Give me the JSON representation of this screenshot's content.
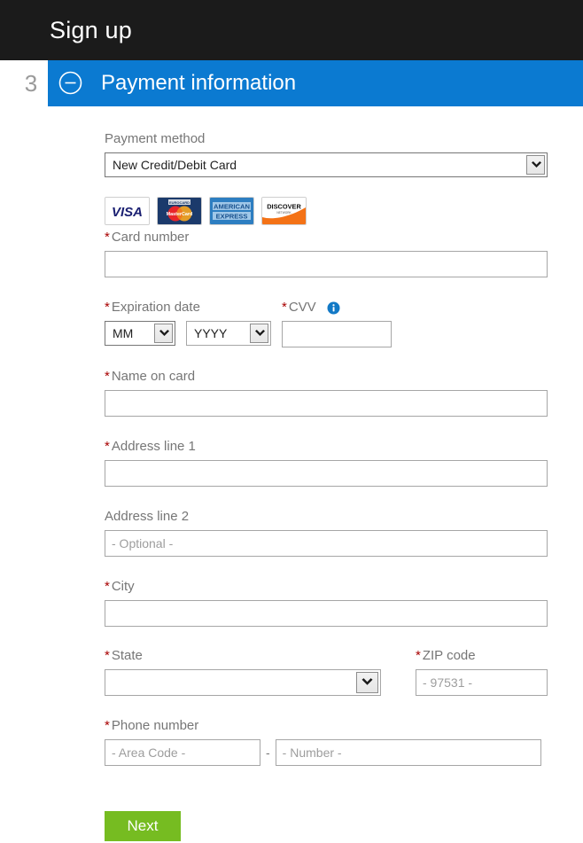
{
  "window": {
    "title": "Sign up"
  },
  "section": {
    "step_number": "3",
    "title": "Payment information",
    "collapse_icon": "circle-minus-icon",
    "accent_color": "#0b7ad1"
  },
  "form": {
    "payment_method": {
      "label": "Payment method",
      "selected": "New Credit/Debit Card",
      "options": [
        "New Credit/Debit Card"
      ]
    },
    "accepted_cards": [
      {
        "name": "visa-logo",
        "label": "VISA"
      },
      {
        "name": "mastercard-logo",
        "label": "MasterCard"
      },
      {
        "name": "amex-logo",
        "label": "AMERICAN EXPRESS"
      },
      {
        "name": "discover-logo",
        "label": "DISCOVER"
      }
    ],
    "card_number": {
      "label": "Card number",
      "required": "*",
      "value": "",
      "placeholder": ""
    },
    "expiration": {
      "label": "Expiration date",
      "required": "*",
      "month": {
        "selected": "MM",
        "options": [
          "MM"
        ]
      },
      "year": {
        "selected": "YYYY",
        "options": [
          "YYYY"
        ]
      }
    },
    "cvv": {
      "label": "CVV",
      "required": "*",
      "value": "",
      "placeholder": "",
      "info_icon": "info-icon"
    },
    "name_on_card": {
      "label": "Name on card",
      "required": "*",
      "value": "",
      "placeholder": ""
    },
    "address_line_1": {
      "label": "Address line 1",
      "required": "*",
      "value": "",
      "placeholder": ""
    },
    "address_line_2": {
      "label": "Address line 2",
      "required": "",
      "value": "",
      "placeholder": "- Optional -"
    },
    "city": {
      "label": "City",
      "required": "*",
      "value": "",
      "placeholder": ""
    },
    "state": {
      "label": "State",
      "required": "*",
      "selected": "",
      "options": []
    },
    "zip_code": {
      "label": "ZIP code",
      "required": "*",
      "value": "",
      "placeholder": "- 97531 -"
    },
    "phone_number": {
      "label": "Phone number",
      "required": "*",
      "area_code": {
        "value": "",
        "placeholder": "- Area Code -"
      },
      "separator": "-",
      "number": {
        "value": "",
        "placeholder": "- Number -"
      }
    },
    "next_button": {
      "label": "Next",
      "color": "#76bc21"
    }
  }
}
